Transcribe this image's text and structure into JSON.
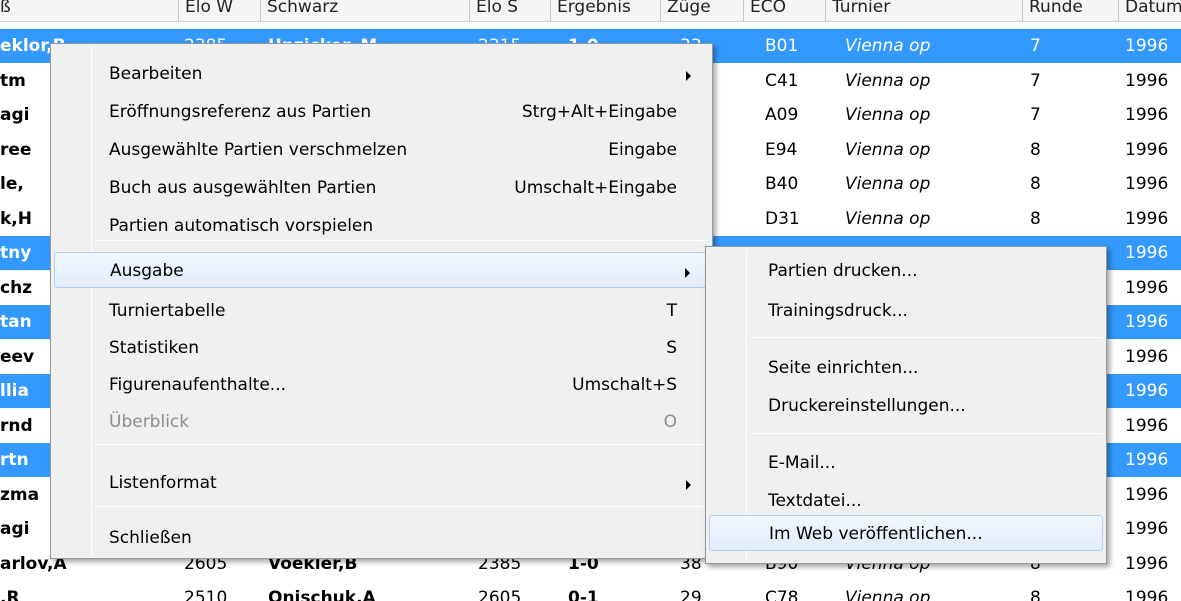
{
  "list": {
    "headers": [
      "ß",
      "Elo W",
      "Schwarz",
      "Elo S",
      "Ergebnis",
      "Züge",
      "ECO",
      "Turnier",
      "Runde",
      "Datum"
    ],
    "rows": [
      {
        "white": "eklor,B",
        "elo_w": "2385",
        "black": "Unzicker, M.",
        "elo_s": "2315",
        "result": "1-0",
        "moves": "33",
        "eco": "B01",
        "event": "Vienna op",
        "round": "7",
        "date": "1996",
        "selected": true
      },
      {
        "white": "tm",
        "elo_w": "",
        "black": "",
        "elo_s": "",
        "result": "",
        "moves": "",
        "eco": "C41",
        "event": "Vienna op",
        "round": "7",
        "date": "1996",
        "selected": false
      },
      {
        "white": "agi",
        "elo_w": "",
        "black": "",
        "elo_s": "",
        "result": "",
        "moves": "",
        "eco": "A09",
        "event": "Vienna op",
        "round": "7",
        "date": "1996",
        "selected": false
      },
      {
        "white": "ree",
        "elo_w": "",
        "black": "",
        "elo_s": "",
        "result": "",
        "moves": "",
        "eco": "E94",
        "event": "Vienna op",
        "round": "8",
        "date": "1996",
        "selected": false
      },
      {
        "white": "le,",
        "elo_w": "",
        "black": "",
        "elo_s": "",
        "result": "",
        "moves": "",
        "eco": "B40",
        "event": "Vienna op",
        "round": "8",
        "date": "1996",
        "selected": false
      },
      {
        "white": "k,H",
        "elo_w": "",
        "black": "",
        "elo_s": "",
        "result": "",
        "moves": "",
        "eco": "D31",
        "event": "Vienna op",
        "round": "8",
        "date": "1996",
        "selected": false
      },
      {
        "white": "tny",
        "elo_w": "",
        "black": "",
        "elo_s": "",
        "result": "",
        "moves": "",
        "eco": "",
        "event": "",
        "round": "",
        "date": "1996",
        "selected": true
      },
      {
        "white": "chz",
        "elo_w": "",
        "black": "",
        "elo_s": "",
        "result": "",
        "moves": "",
        "eco": "",
        "event": "",
        "round": "",
        "date": "1996",
        "selected": false
      },
      {
        "white": "tan",
        "elo_w": "",
        "black": "",
        "elo_s": "",
        "result": "",
        "moves": "",
        "eco": "",
        "event": "",
        "round": "",
        "date": "1996",
        "selected": true
      },
      {
        "white": "eev",
        "elo_w": "",
        "black": "",
        "elo_s": "",
        "result": "",
        "moves": "",
        "eco": "",
        "event": "",
        "round": "",
        "date": "1996",
        "selected": false
      },
      {
        "white": "llia",
        "elo_w": "",
        "black": "",
        "elo_s": "",
        "result": "",
        "moves": "",
        "eco": "",
        "event": "",
        "round": "",
        "date": "1996",
        "selected": true
      },
      {
        "white": "rnd",
        "elo_w": "",
        "black": "",
        "elo_s": "",
        "result": "",
        "moves": "",
        "eco": "",
        "event": "",
        "round": "",
        "date": "1996",
        "selected": false
      },
      {
        "white": "rtn",
        "elo_w": "",
        "black": "",
        "elo_s": "",
        "result": "",
        "moves": "",
        "eco": "",
        "event": "",
        "round": "",
        "date": "1996",
        "selected": true
      },
      {
        "white": "zma",
        "elo_w": "",
        "black": "",
        "elo_s": "",
        "result": "",
        "moves": "",
        "eco": "",
        "event": "",
        "round": "",
        "date": "1996",
        "selected": false
      },
      {
        "white": "agi",
        "elo_w": "",
        "black": "",
        "elo_s": "",
        "result": "",
        "moves": "",
        "eco": "",
        "event": "",
        "round": "",
        "date": "1996",
        "selected": false
      },
      {
        "white": "arlov,A",
        "elo_w": "2605",
        "black": "Voekler,B",
        "elo_s": "2385",
        "result": "1-0",
        "moves": "38",
        "eco": "B90",
        "event": "Vienna op",
        "round": "8",
        "date": "1996",
        "selected": false
      },
      {
        "white": ",R",
        "elo_w": "2510",
        "black": "Onischuk,A",
        "elo_s": "2605",
        "result": "0-1",
        "moves": "29",
        "eco": "C78",
        "event": "Vienna op",
        "round": "8",
        "date": "1996",
        "selected": false
      }
    ]
  },
  "context_menu": {
    "items": [
      {
        "label": "Bearbeiten",
        "shortcut": "",
        "submenu": true,
        "disabled": false,
        "highlighted": false
      },
      {
        "label": "Eröffnungsreferenz aus Partien",
        "shortcut": "Strg+Alt+Eingabe",
        "submenu": false,
        "disabled": false,
        "highlighted": false
      },
      {
        "label": "Ausgewählte Partien verschmelzen",
        "shortcut": "Eingabe",
        "submenu": false,
        "disabled": false,
        "highlighted": false
      },
      {
        "label": "Buch aus ausgewählten Partien",
        "shortcut": "Umschalt+Eingabe",
        "submenu": false,
        "disabled": false,
        "highlighted": false
      },
      {
        "label": "Partien automatisch vorspielen",
        "shortcut": "",
        "submenu": false,
        "disabled": false,
        "highlighted": false
      },
      {
        "label": "Ausgabe",
        "shortcut": "",
        "submenu": true,
        "disabled": false,
        "highlighted": true
      },
      {
        "label": "Turniertabelle",
        "shortcut": "T",
        "submenu": false,
        "disabled": false,
        "highlighted": false
      },
      {
        "label": "Statistiken",
        "shortcut": "S",
        "submenu": false,
        "disabled": false,
        "highlighted": false
      },
      {
        "label": "Figurenaufenthalte...",
        "shortcut": "Umschalt+S",
        "submenu": false,
        "disabled": false,
        "highlighted": false
      },
      {
        "label": "Überblick",
        "shortcut": "O",
        "submenu": false,
        "disabled": true,
        "highlighted": false
      },
      {
        "label": "Listenformat",
        "shortcut": "",
        "submenu": true,
        "disabled": false,
        "highlighted": false
      },
      {
        "label": "Schließen",
        "shortcut": "",
        "submenu": false,
        "disabled": false,
        "highlighted": false
      }
    ]
  },
  "submenu": {
    "items": [
      {
        "label": "Partien drucken...",
        "highlighted": false
      },
      {
        "label": "Trainingsdruck...",
        "highlighted": false
      },
      {
        "label": "Seite einrichten...",
        "highlighted": false
      },
      {
        "label": "Druckereinstellungen...",
        "highlighted": false
      },
      {
        "label": "E-Mail...",
        "highlighted": false
      },
      {
        "label": "Textdatei...",
        "highlighted": false
      },
      {
        "label": "Im Web veröffentlichen...",
        "highlighted": true
      }
    ]
  }
}
